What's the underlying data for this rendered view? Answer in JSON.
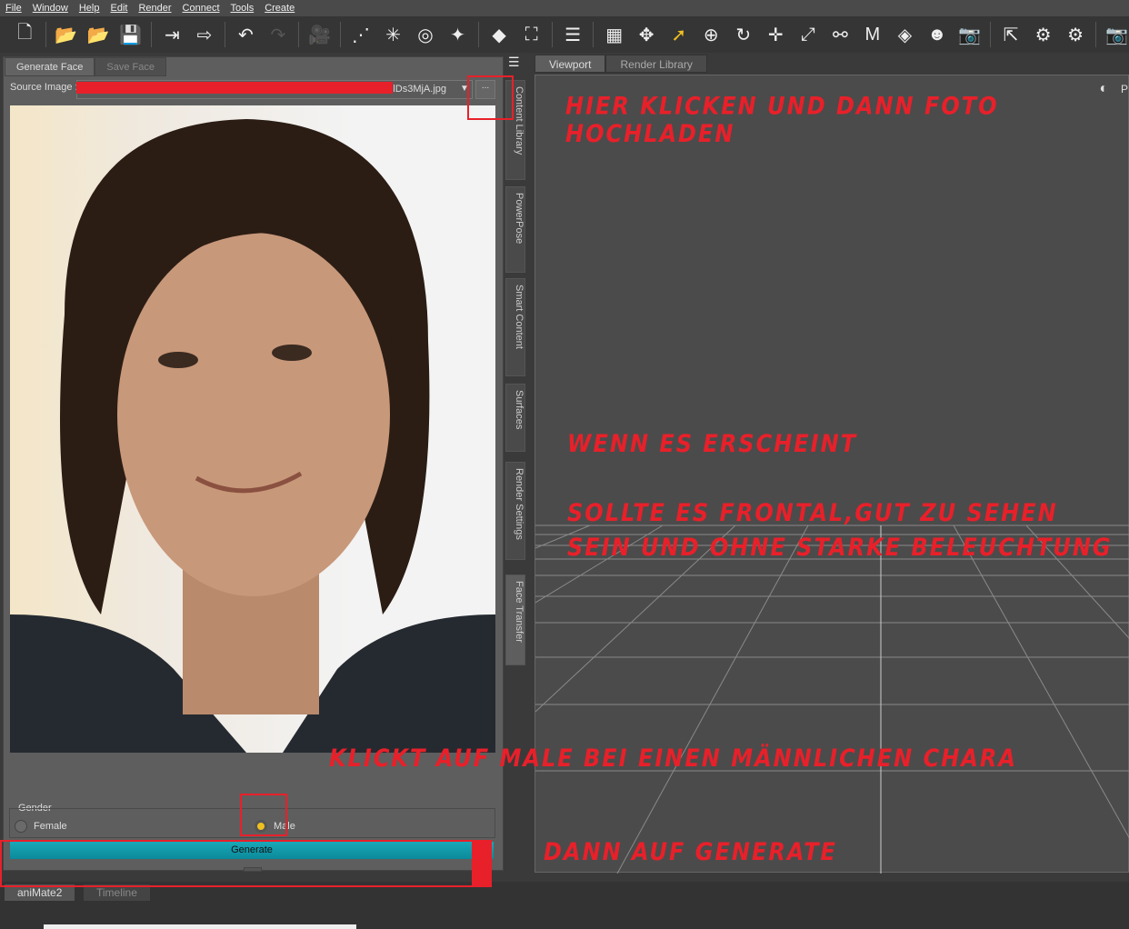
{
  "menu": [
    "File",
    "Window",
    "Help",
    "Edit",
    "Render",
    "Connect",
    "Tools",
    "Create"
  ],
  "toolbar_icons": [
    "new-file",
    "open",
    "open-merge",
    "save",
    "import",
    "export",
    "undo",
    "redo",
    "create-camera",
    "create-distant-light",
    "create-spot-light",
    "create-point-light",
    "create-light",
    "create-primitive",
    "create-null",
    "align",
    "pane-select",
    "universal",
    "select-pointer",
    "node-select",
    "rotate",
    "translate",
    "scale",
    "joint-editor",
    "morph",
    "surface-selector",
    "figure-pose",
    "camera-view",
    "region-nav",
    "geometry-editor",
    "render-settings",
    "render"
  ],
  "left_panel": {
    "tabs": [
      "Generate Face",
      "Save Face"
    ],
    "source_label": "Source Image :",
    "source_value": "...lDs3MjA.jpg",
    "browse_label": "...",
    "gender_label": "Gender",
    "female_label": "Female",
    "male_label": "Male",
    "selected_gender": "Male",
    "generate_label": "Generate"
  },
  "side_tabs": [
    "Content Library",
    "PowerPose",
    "Smart Content",
    "Surfaces",
    "Render Settings",
    "Face Transfer"
  ],
  "viewport_tabs": [
    "Viewport",
    "Render Library"
  ],
  "viewport_corner": "P",
  "bottom_tabs": [
    "aniMate2",
    "Timeline"
  ],
  "annotations": {
    "a1": "HIER KLICKEN UND DANN FOTO HOCHLADEN",
    "a2": "WENN ES ERSCHEINT",
    "a3": "SOLLTE ES FRONTAL,GUT ZU SEHEN",
    "a4": "SEIN UND OHNE STARKE BELEUCHTUNG",
    "a5": "KLICKT AUF MALE BEI EINEN MÄNNLICHEN CHARA",
    "a6": "DANN AUF GENERATE"
  },
  "colors": {
    "annotation": "#e8202a",
    "generate": "#1aa8b8",
    "radio_selected": "#f0c020"
  }
}
